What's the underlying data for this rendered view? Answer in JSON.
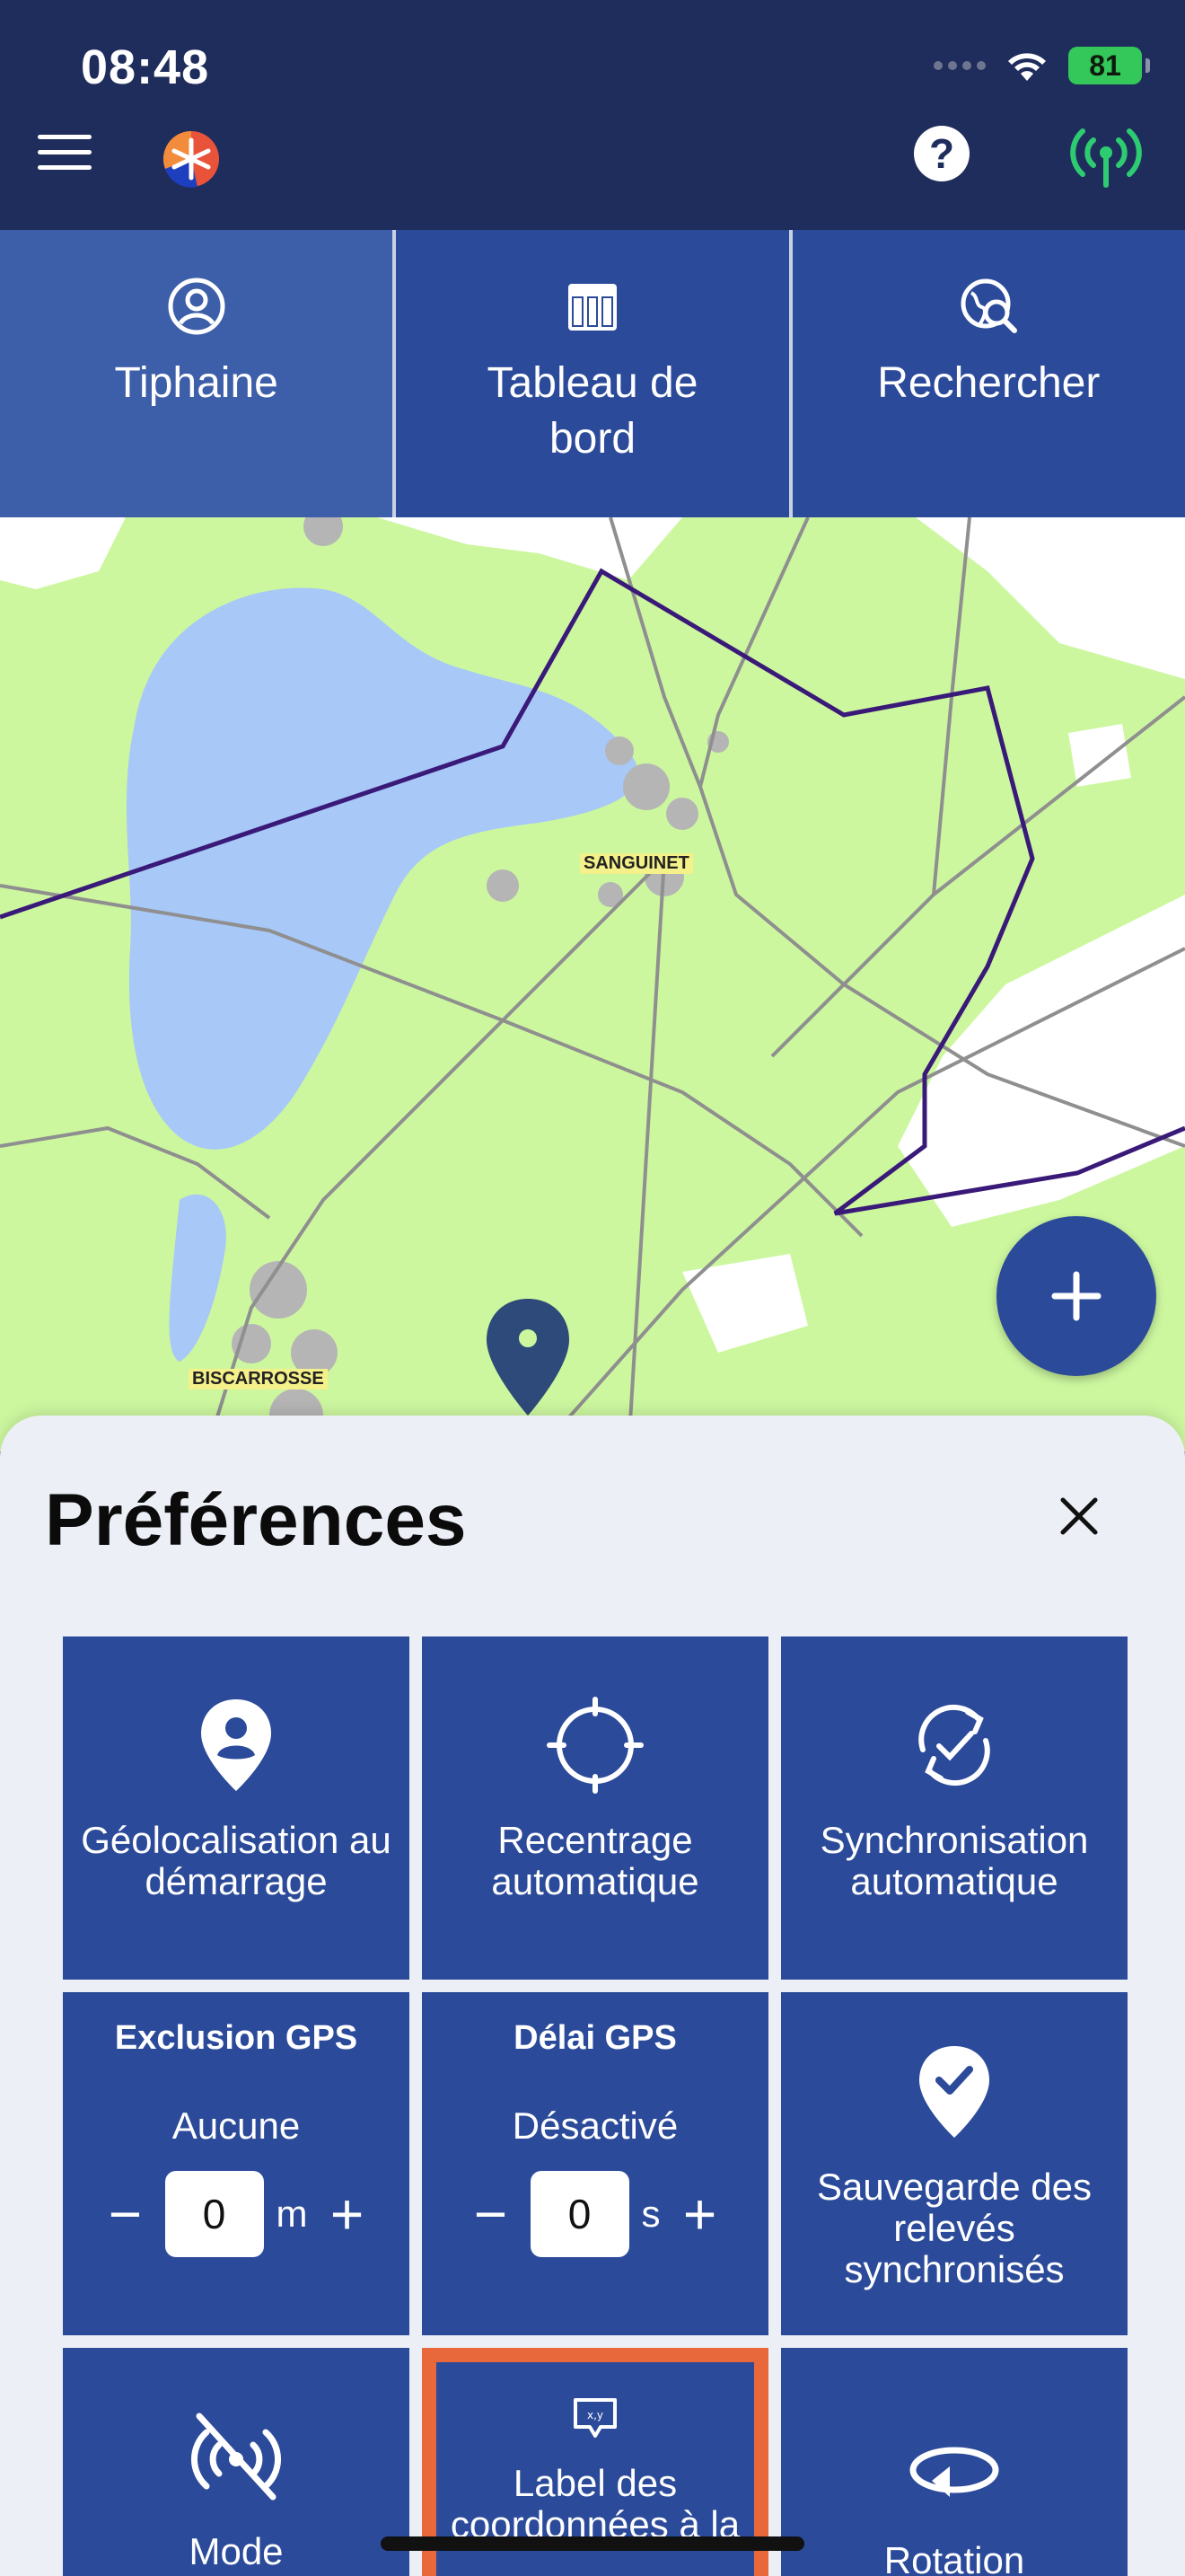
{
  "status_bar": {
    "time": "08:48",
    "battery": "81"
  },
  "header": {
    "menu_icon": "hamburger-icon",
    "logo_icon": "app-logo",
    "help_icon": "help-icon",
    "help_glyph": "?",
    "connection_icon": "antenna-icon",
    "connection_color": "#2ecc71"
  },
  "nav": {
    "items": [
      {
        "label": "Tiphaine",
        "icon": "user-icon"
      },
      {
        "label": "Tableau de bord",
        "icon": "table-icon"
      },
      {
        "label": "Rechercher",
        "icon": "search-map-icon"
      }
    ]
  },
  "map": {
    "labels": [
      "SANGUINET",
      "BISCARROSSE"
    ],
    "fab_icon": "plus-icon"
  },
  "preferences": {
    "title": "Préférences",
    "close_icon": "close-icon",
    "tiles": [
      {
        "label": "Géolocalisation au démarrage",
        "icon": "location-person-icon"
      },
      {
        "label": "Recentrage automatique",
        "icon": "crosshair-icon"
      },
      {
        "label": "Synchronisation automatique",
        "icon": "sync-check-icon"
      },
      {
        "heading": "Exclusion GPS",
        "value": "Aucune",
        "input": "0",
        "unit": "m"
      },
      {
        "heading": "Délai GPS",
        "value": "Désactivé",
        "input": "0",
        "unit": "s"
      },
      {
        "label": "Sauvegarde des relevés synchronisés",
        "icon": "pin-check-icon"
      },
      {
        "label": "Mode",
        "icon": "no-signal-icon"
      },
      {
        "label": "Label des coordonnées à la",
        "icon": "coordinates-label-icon",
        "highlighted": true
      },
      {
        "label": "Rotation",
        "icon": "rotation-icon"
      }
    ],
    "stepper_minus": "−",
    "stepper_plus": "+"
  },
  "colors": {
    "primary": "#2b4a9a",
    "header": "#1f2d5c",
    "highlight": "#e8683c",
    "map_land": "#ccf79f",
    "map_water": "#a8c8f8"
  }
}
